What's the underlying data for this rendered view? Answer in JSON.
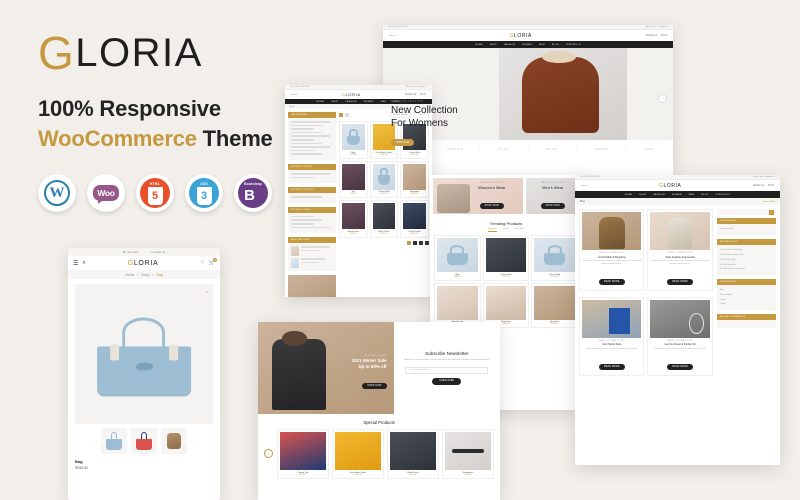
{
  "promo": {
    "logo_text": "LORIA",
    "logo_initial": "G",
    "tagline_1": "100% Responsive",
    "tagline_2_accent": "WooCommerce",
    "tagline_2_rest": " Theme",
    "accent_color": "#c4993f",
    "background_color": "#f2efeb"
  },
  "badges": [
    {
      "name": "wordpress-badge",
      "label": "W",
      "title": "WordPress"
    },
    {
      "name": "woocommerce-badge",
      "label": "Woo",
      "title": "WooCommerce"
    },
    {
      "name": "html5-badge",
      "label": "5",
      "top": "HTML",
      "title": "HTML5"
    },
    {
      "name": "css3-badge",
      "label": "3",
      "top": "CSS",
      "title": "CSS3"
    },
    {
      "name": "bootstrap-badge",
      "label": "B",
      "top": "Bootstrap",
      "title": "Bootstrap"
    }
  ],
  "common": {
    "brand_initial": "G",
    "brand_rest": "LORIA",
    "topbar_phone": "Tel: (+00) 1234 5678",
    "topbar_links": [
      "My account",
      "Contact us"
    ],
    "nav_items": [
      "HOME",
      "SHOP",
      "FASHION",
      "WOMEN",
      "MEN",
      "BLOG",
      "PORTFOLIO"
    ],
    "search_placeholder": "Search",
    "wishlist_label": "Wishlist (0)",
    "cart_label": "$0.00"
  },
  "hero": {
    "eyebrow": "NEW COLLECTION",
    "title_line1": "New Collection",
    "title_line2": "For Womens",
    "cta": "SHOP NOW",
    "brands": [
      "ELITE",
      "CLASSIC",
      "Fiesta",
      "ROYAL",
      "VOGUE",
      "LUXE"
    ]
  },
  "shop": {
    "breadcrumb": "Shop",
    "sidebar_blocks": [
      "CATEGORIES",
      "FILTER BY PRICE",
      "FILTER BY COLOR",
      "PRODUCT TAGS",
      "BEST SELLERS"
    ],
    "sort_label": "Default sorting",
    "show_label": "Show 9",
    "products": [
      {
        "name": "Bag",
        "price": "$256.52"
      },
      {
        "name": "Cap Sleeve Dress",
        "price": "$180.00"
      },
      {
        "name": "Casual Shirt",
        "price": "$120.00"
      },
      {
        "name": "Top",
        "price": "$99.00"
      },
      {
        "name": "Classic Bag",
        "price": "$210.00"
      },
      {
        "name": "Backpack",
        "price": "$160.00"
      },
      {
        "name": "Floral Dress",
        "price": "$145.00"
      },
      {
        "name": "Black Dress",
        "price": "$175.00"
      },
      {
        "name": "Denim Jeans",
        "price": "$130.00"
      }
    ]
  },
  "home": {
    "banner_left_sub": "NEW COLLECTION",
    "banner_left_title": "Women's Wear",
    "banner_right_sub": "NEW COLLECTION",
    "banner_right_title": "Men's Wear",
    "banner_cta": "SHOP NOW",
    "trending_title": "Trending Products",
    "tabs": [
      "Featured",
      "Latest",
      "Bestseller"
    ],
    "products": [
      {
        "name": "Bag",
        "price": "$256.52"
      },
      {
        "name": "Casual Shirt",
        "price": "$120.00",
        "tag": "SALE"
      },
      {
        "name": "Classic Bag",
        "price": "$210.00"
      },
      {
        "name": "Summer Top",
        "price": "$88.00",
        "tag": "NEW"
      },
      {
        "name": "Day Dress",
        "price": "$145.00"
      },
      {
        "name": "Backpack",
        "price": "$160.00"
      }
    ]
  },
  "newsletter": {
    "sale_eyebrow": "SPECIAL OFFER",
    "sale_line1": "2021 Winter Sale",
    "sale_line2": "Up to 60% off",
    "sale_cta": "SHOP NOW",
    "title": "Subscribe Newsletter",
    "description": "Subscribe to our newsletter now and stay up to date with new collections and exclusive offers.",
    "input_placeholder": "Enter your email...",
    "button": "SUBSCRIBE",
    "special_title": "Special Products",
    "special_products": [
      {
        "name": "Printed Tote",
        "price": "$256.52",
        "tag": "SALE"
      },
      {
        "name": "Cap Sleeve Dress",
        "price": "$180.00",
        "tag": "NEW"
      },
      {
        "name": "Black Dress",
        "price": "$175.00",
        "tag": "SALE"
      },
      {
        "name": "Sunglasses",
        "price": "$78.00",
        "tag": "NEW"
      }
    ]
  },
  "blog": {
    "breadcrumb": "Blog",
    "breadcrumb_right": "Home / Blog",
    "posts": [
      {
        "meta": "ADMIN  •  OCTOBER 20, 2021",
        "title": "Comfortable & Beguiling",
        "excerpt": "Lorem ipsum dolor sit amet consectetur adipiscing elit sed do eiusmod tempor incididunt labore.",
        "cta": "READ MORE"
      },
      {
        "meta": "ADMIN  •  OCTOBER 18, 2021",
        "title": "Start Fashion Augmented",
        "excerpt": "Lorem ipsum dolor sit amet consectetur adipiscing elit sed do eiusmod tempor incididunt labore.",
        "cta": "READ MORE"
      },
      {
        "meta": "ADMIN  •  OCTOBER 14, 2021",
        "title": "Cool Street Style",
        "excerpt": "Lorem ipsum dolor sit amet consectetur adipiscing elit sed do.",
        "cta": "READ MORE"
      },
      {
        "meta": "ADMIN  •  OCTOBER 10, 2021",
        "title": "Get the Finest & Perfect Fit",
        "excerpt": "Lorem ipsum dolor sit amet consectetur adipiscing elit sed do.",
        "cta": "READ MORE"
      }
    ],
    "sidebar": [
      {
        "heading": "CATEGORIES",
        "items": [
          "Uncategorized"
        ]
      },
      {
        "heading": "RECENT POST",
        "items": [
          "Comfortable & Beguiling",
          "Start Fashion Augmented",
          "Cool Street Style",
          "Get the Finest Fit",
          "The Weekend Looks Good"
        ]
      },
      {
        "heading": "CATEGORIES",
        "items": [
          "Bag",
          "Casual Wear",
          "Jacket",
          "Ladies"
        ]
      },
      {
        "heading": "RECENT COMMENTS",
        "items": []
      }
    ],
    "search_placeholder": "Search"
  },
  "mobile": {
    "topbar_links": [
      "My account",
      "Contact us"
    ],
    "cart_count": "0",
    "breadcrumb": [
      "Home",
      "Shop",
      "Bag"
    ],
    "product_name": "Bag",
    "product_price": "₹256.52",
    "thumbs": [
      "Blue Tote",
      "Red Tote",
      "Backpack"
    ]
  }
}
